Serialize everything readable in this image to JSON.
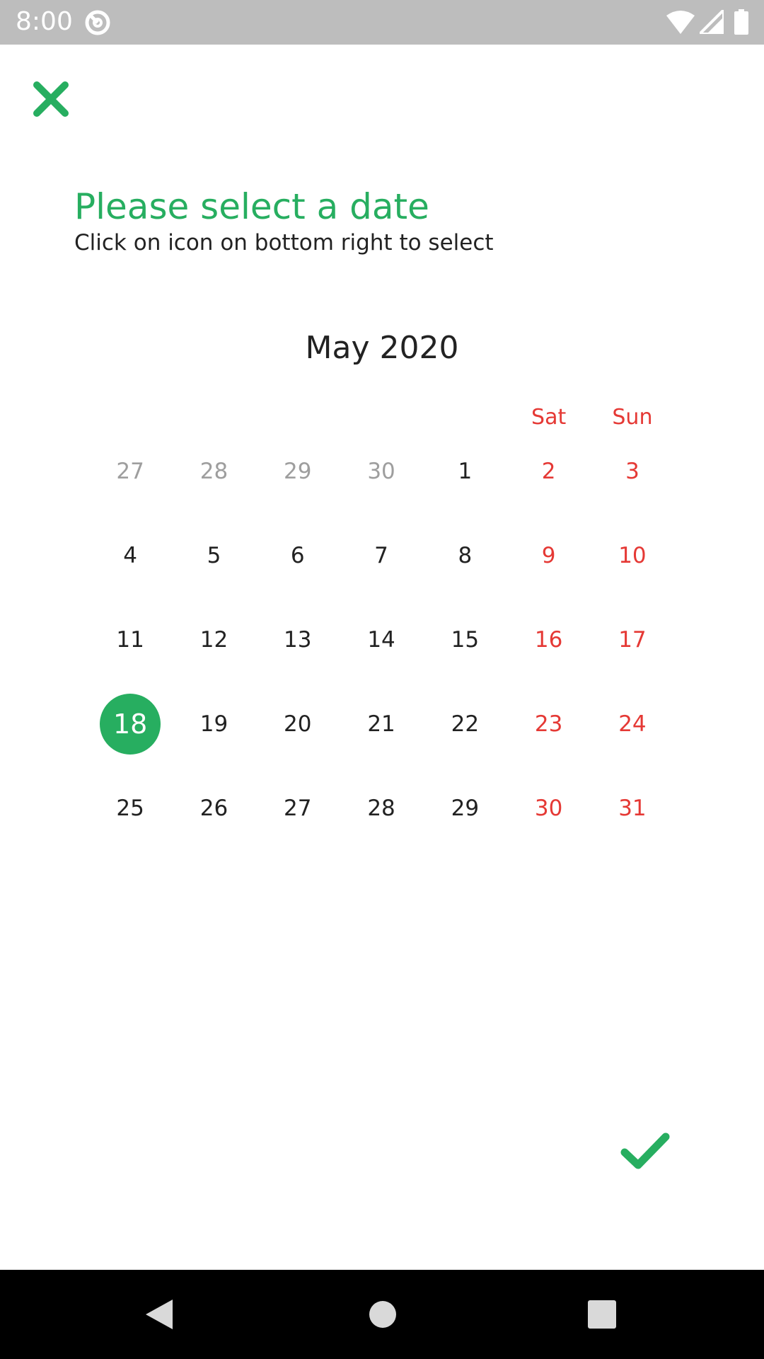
{
  "status_bar": {
    "time": "8:00"
  },
  "header": {
    "close_icon": "close-icon",
    "title": "Please select a date",
    "subtitle": "Click on icon on bottom right to select"
  },
  "calendar": {
    "month_label": "May 2020",
    "weekday_headers": [
      "",
      "",
      "",
      "",
      "",
      "Sat",
      "Sun"
    ],
    "weeks": [
      [
        "27",
        "28",
        "29",
        "30",
        "1",
        "2",
        "3"
      ],
      [
        "4",
        "5",
        "6",
        "7",
        "8",
        "9",
        "10"
      ],
      [
        "11",
        "12",
        "13",
        "14",
        "15",
        "16",
        "17"
      ],
      [
        "18",
        "19",
        "20",
        "21",
        "22",
        "23",
        "24"
      ],
      [
        "25",
        "26",
        "27",
        "28",
        "29",
        "30",
        "31"
      ]
    ],
    "outside_month": [
      [
        true,
        true,
        true,
        true,
        false,
        false,
        false
      ],
      [
        false,
        false,
        false,
        false,
        false,
        false,
        false
      ],
      [
        false,
        false,
        false,
        false,
        false,
        false,
        false
      ],
      [
        false,
        false,
        false,
        false,
        false,
        false,
        false
      ],
      [
        false,
        false,
        false,
        false,
        false,
        false,
        false
      ]
    ],
    "selected_date": "18"
  },
  "actions": {
    "confirm_icon": "checkmark-icon"
  },
  "colors": {
    "accent": "#27ae60",
    "weekend": "#e53935",
    "outside_month": "#9e9e9e",
    "text": "#222222",
    "status_bar": "#bdbdbd"
  }
}
